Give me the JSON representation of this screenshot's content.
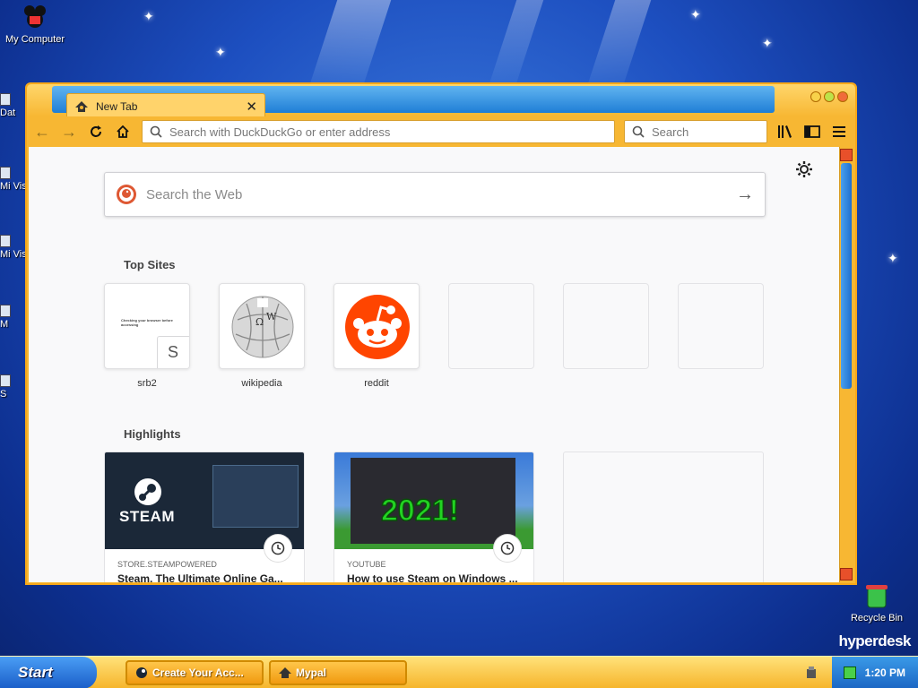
{
  "desktop": {
    "icons": [
      {
        "label": "My Computer"
      },
      {
        "label": "Recycle Bin"
      }
    ],
    "left_fragments": [
      "Dat",
      "Mi Vis",
      "Mi Vis",
      "M",
      "S"
    ],
    "brand": "hyperdesk"
  },
  "browser": {
    "tab": {
      "title": "New Tab"
    },
    "urlbar": {
      "placeholder": "Search with DuckDuckGo or enter address"
    },
    "searchbar": {
      "placeholder": "Search"
    },
    "newtab": {
      "web_search_placeholder": "Search the Web",
      "top_sites_title": "Top Sites",
      "top_sites": [
        {
          "name": "srb2",
          "letter": "S",
          "page_text": "Checking your browser before accessing"
        },
        {
          "name": "wikipedia"
        },
        {
          "name": "reddit"
        },
        {
          "name": ""
        },
        {
          "name": ""
        },
        {
          "name": ""
        }
      ],
      "highlights_title": "Highlights",
      "highlights": [
        {
          "source": "STORE.STEAMPOWERED",
          "title": "Steam, The Ultimate Online Ga...",
          "thumb_text": "STEAM"
        },
        {
          "source": "YOUTUBE",
          "title": "How to use Steam on Windows ...",
          "thumb_text": "2021!"
        }
      ]
    }
  },
  "taskbar": {
    "start_label": "Start",
    "tasks": [
      {
        "label": "Create Your Acc..."
      },
      {
        "label": "Mypal"
      }
    ],
    "clock": "1:20 PM"
  },
  "colors": {
    "accent": "#f7b733",
    "desktop": "#1d4fc0",
    "reddit": "#ff4500",
    "steam_bg": "#1b2838"
  }
}
